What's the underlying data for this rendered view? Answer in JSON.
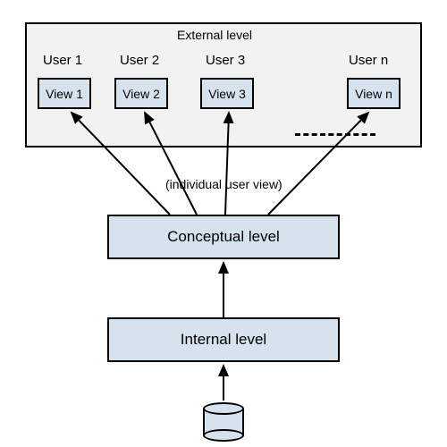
{
  "external": {
    "topLabel": "External level",
    "users": [
      "User 1",
      "User 2",
      "User 3",
      "User n"
    ],
    "views": [
      "View 1",
      "View 2",
      "View 3",
      "View n"
    ],
    "bottomLabel": "(individual user view)"
  },
  "conceptual": {
    "label": "Conceptual level"
  },
  "internal": {
    "label": "Internal level"
  },
  "storage": {
    "shape": "cylinder"
  },
  "colors": {
    "fill": "#d6e3ef",
    "panel": "#f2f2f2",
    "stroke": "#000000"
  }
}
